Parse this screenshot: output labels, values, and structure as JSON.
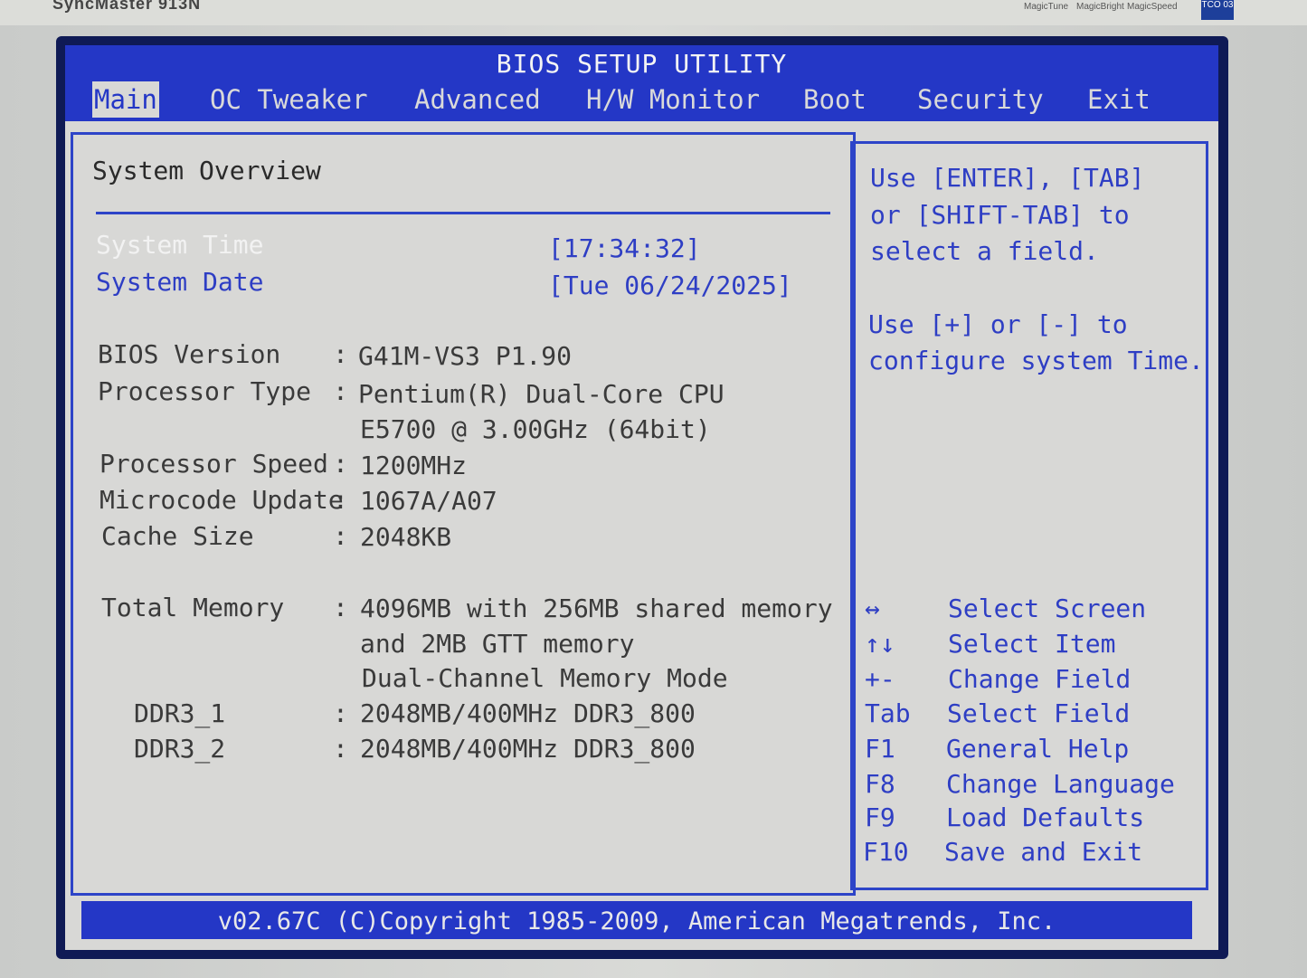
{
  "monitor": {
    "model": "SyncMaster 913N",
    "badges": [
      "MagicTune",
      "MagicBright",
      "MagicSpeed",
      "TCO 03"
    ]
  },
  "bios": {
    "title": "BIOS SETUP UTILITY",
    "menu": [
      "Main",
      "OC Tweaker",
      "Advanced",
      "H/W Monitor",
      "Boot",
      "Security",
      "Exit"
    ],
    "active_menu": "Main",
    "overview_title": "System Overview",
    "system_time_label": "System Time",
    "system_time_value": "[17:34:32]",
    "system_date_label": "System Date",
    "system_date_value": "[Tue 06/24/2025]",
    "info": [
      {
        "label": "BIOS Version",
        "sep": ":",
        "value": "G41M-VS3 P1.90"
      },
      {
        "label": "Processor Type",
        "sep": ":",
        "value": "Pentium(R) Dual-Core  CPU"
      },
      {
        "label": "",
        "sep": "",
        "value": "E5700  @ 3.00GHz (64bit)"
      },
      {
        "label": "Processor Speed",
        "sep": ":",
        "value": "1200MHz"
      },
      {
        "label": "Microcode Update",
        "sep": ":",
        "value": "1067A/A07"
      },
      {
        "label": "Cache Size",
        "sep": ":",
        "value": "2048KB"
      },
      {
        "label": "Total Memory",
        "sep": ":",
        "value": "4096MB with 256MB shared memory"
      },
      {
        "label": "",
        "sep": "",
        "value": "and 2MB GTT memory"
      },
      {
        "label": "",
        "sep": "",
        "value": "Dual-Channel Memory Mode"
      },
      {
        "label": "DDR3_1",
        "sep": ":",
        "value": "2048MB/400MHz DDR3_800"
      },
      {
        "label": "DDR3_2",
        "sep": ":",
        "value": "2048MB/400MHz DDR3_800"
      }
    ],
    "help_lines": [
      "Use [ENTER], [TAB]",
      "or [SHIFT-TAB] to",
      "select a field.",
      "Use [+] or [-] to",
      "configure system Time."
    ],
    "keys": [
      {
        "key": "↔",
        "action": "Select Screen"
      },
      {
        "key": "↑↓",
        "action": "Select Item"
      },
      {
        "key": "+-",
        "action": "Change Field"
      },
      {
        "key": "Tab",
        "action": "Select Field"
      },
      {
        "key": "F1",
        "action": "General Help"
      },
      {
        "key": "F8",
        "action": "Change Language"
      },
      {
        "key": "F9",
        "action": "Load Defaults"
      },
      {
        "key": "F10",
        "action": "Save and Exit"
      }
    ],
    "footer": "v02.67C (C)Copyright 1985-2009, American Megatrends, Inc."
  },
  "colors": {
    "bios_blue": "#2437c6",
    "screen_bg": "#d8d8d6",
    "text_blue": "#2e3ec4"
  }
}
